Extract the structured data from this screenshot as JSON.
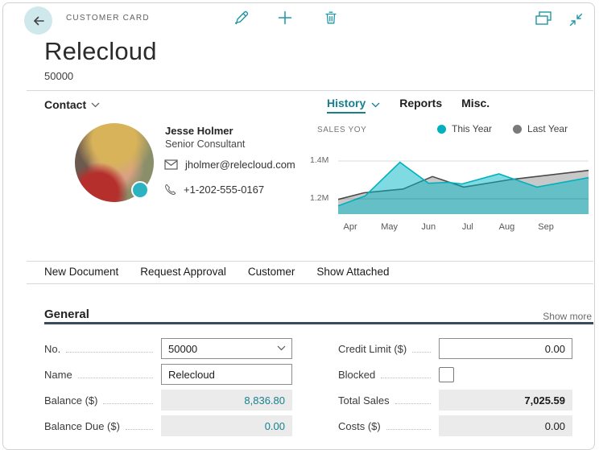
{
  "colors": {
    "accent": "#17808d",
    "accent_bright": "#00b1bd",
    "back_circle_bg": "#cfe8ec",
    "readonly_bg": "#ebebeb",
    "section_underline": "#3a4a5c",
    "separator": "#d8d8d8"
  },
  "header": {
    "page_type_label": "CUSTOMER CARD",
    "title": "Relecloud",
    "subtitle": "50000",
    "icons": [
      "back-arrow",
      "pencil-edit",
      "plus-new",
      "trash-delete",
      "popout-windows",
      "collapse-arrows"
    ]
  },
  "contact": {
    "section_label": "Contact",
    "name": "Jesse Holmer",
    "role": "Senior Consultant",
    "email": "jholmer@relecloud.com",
    "phone": "+1-202-555-0167"
  },
  "insights": {
    "tabs": [
      {
        "label": "History",
        "active": true
      },
      {
        "label": "Reports",
        "active": false
      },
      {
        "label": "Misc.",
        "active": false
      }
    ]
  },
  "chart_data": {
    "type": "area",
    "title": "SALES YOY",
    "categories": [
      "Apr",
      "May",
      "Jun",
      "Jul",
      "Aug",
      "Sep"
    ],
    "x_unit": "month index (Apr=0)",
    "xlim": [
      -0.31,
      6.09
    ],
    "ylim": [
      1.119,
      1.434
    ],
    "y_unit": "millions",
    "gridlines": [
      1.2,
      1.4
    ],
    "yticks": [
      {
        "label": "1.4M",
        "value": 1.4
      },
      {
        "label": "1.2M",
        "value": 1.2
      }
    ],
    "legend": [
      {
        "label": "This Year",
        "color": "#00b1bd"
      },
      {
        "label": "Last Year",
        "color": "#7a7a7a"
      }
    ],
    "legend_position": "top-right",
    "series": [
      {
        "name": "Last Year",
        "color": "#4a4a4a",
        "fill": "rgba(96,96,96,0.35)",
        "points": [
          [
            -0.31,
            1.197
          ],
          [
            0.35,
            1.232
          ],
          [
            1.0,
            1.245
          ],
          [
            1.35,
            1.252
          ],
          [
            2.1,
            1.318
          ],
          [
            2.9,
            1.262
          ],
          [
            4.1,
            1.302
          ],
          [
            6.09,
            1.35
          ]
        ]
      },
      {
        "name": "This Year",
        "color": "#00b1bd",
        "fill": "rgba(0,183,195,0.5)",
        "points": [
          [
            -0.31,
            1.163
          ],
          [
            0.38,
            1.215
          ],
          [
            1.27,
            1.393
          ],
          [
            2.0,
            1.282
          ],
          [
            2.5,
            1.287
          ],
          [
            2.85,
            1.278
          ],
          [
            3.8,
            1.332
          ],
          [
            4.77,
            1.262
          ],
          [
            6.09,
            1.312
          ]
        ]
      }
    ]
  },
  "actions": [
    "New Document",
    "Request Approval",
    "Customer",
    "Show Attached"
  ],
  "general": {
    "heading": "General",
    "show_more": "Show more",
    "left": [
      {
        "label": "No.",
        "value": "50000",
        "kind": "combobox"
      },
      {
        "label": "Name",
        "value": "Relecloud",
        "kind": "input"
      },
      {
        "label": "Balance ($)",
        "value": "8,836.80",
        "kind": "readonly-teal"
      },
      {
        "label": "Balance Due ($)",
        "value": "0.00",
        "kind": "readonly-teal"
      }
    ],
    "right": [
      {
        "label": "Credit Limit ($)",
        "value": "0.00",
        "kind": "input-number"
      },
      {
        "label": "Blocked",
        "checked": false,
        "kind": "checkbox"
      },
      {
        "label": "Total Sales",
        "value": "7,025.59",
        "kind": "readonly-bold"
      },
      {
        "label": "Costs ($)",
        "value": "0.00",
        "kind": "readonly"
      }
    ]
  }
}
